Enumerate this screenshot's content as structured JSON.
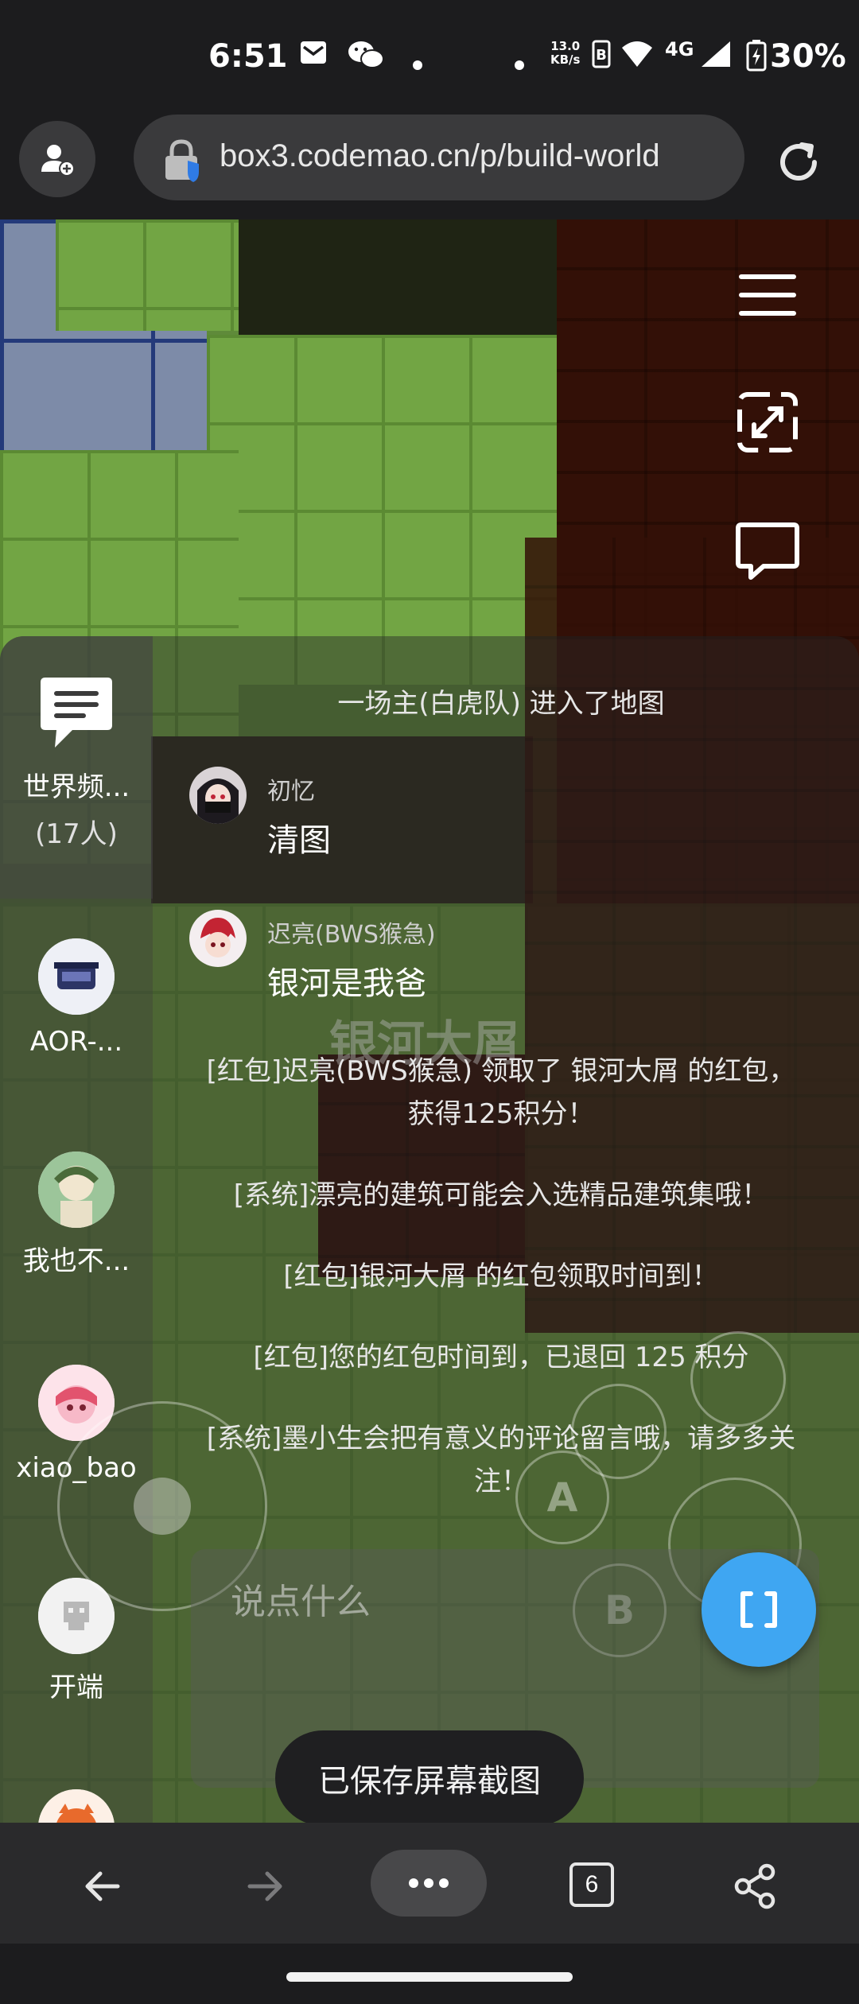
{
  "status_bar": {
    "time": "6:51",
    "net_speed_value": "13.0",
    "net_speed_unit": "KB/s",
    "network_type": "4G",
    "battery_percent": "30%",
    "icons": [
      "mail-icon",
      "wechat-icon",
      "dot-icon",
      "dot-icon",
      "hd-icon",
      "wifi-icon",
      "signal-icon",
      "battery-icon"
    ]
  },
  "browser": {
    "url": "box3.codemao.cn/p/build-world"
  },
  "game": {
    "watermark": "银河大屑",
    "controls": {
      "a_label": "A",
      "b_label": "B"
    }
  },
  "chat": {
    "channels": [
      {
        "label": "世界频...",
        "count": "(17人)"
      },
      {
        "label": "AOR-..."
      },
      {
        "label": "我也不..."
      },
      {
        "label": "xiao_bao"
      },
      {
        "label": "开端"
      }
    ],
    "messages": [
      {
        "kind": "system",
        "text": "一场主(白虎队) 进入了地图"
      },
      {
        "kind": "user",
        "name": "初忆",
        "text": "清图"
      },
      {
        "kind": "user",
        "name": "迟亮(BWS猴急)",
        "text": "银河是我爸"
      },
      {
        "kind": "system",
        "text_line1": "[红包]迟亮(BWS猴急) 领取了 银河大屑 的红包，",
        "text_line2": "获得125积分！"
      },
      {
        "kind": "system",
        "text": "[系统]漂亮的建筑可能会入选精品建筑集哦！"
      },
      {
        "kind": "system",
        "text": "[红包]银河大屑 的红包领取时间到！"
      },
      {
        "kind": "system",
        "text": "[红包]您的红包时间到，已退回 125 积分"
      },
      {
        "kind": "system",
        "text_line1": "[系统]墨小生会把有意义的评论留言哦，请多多关",
        "text_line2": "注！"
      }
    ],
    "input_placeholder": "说点什么"
  },
  "toast": "已保存屏幕截图",
  "bottom_nav": {
    "tab_count": "6"
  }
}
